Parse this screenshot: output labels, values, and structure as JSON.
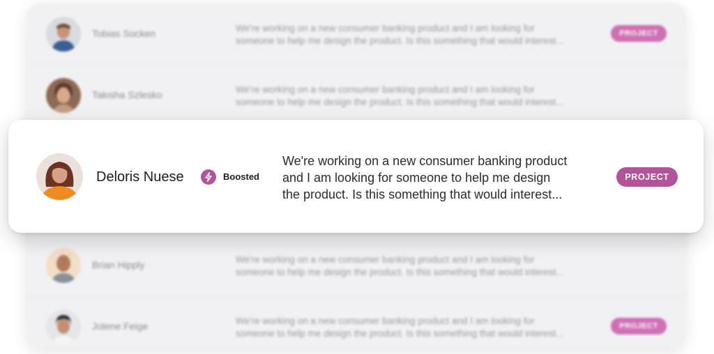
{
  "rows": [
    {
      "name": "Tobias Socken",
      "message_line1": "We're working on a new consumer banking product and I am looking for",
      "message_line2": "someone to help me design the product. Is this something that would interest...",
      "tag": "PROJECT"
    },
    {
      "name": "Takisha Szlesko",
      "message_line1": "We're working on a new consumer banking product and I am looking for",
      "message_line2": "someone to help me design the product. Is this something that would interest...",
      "tag": ""
    },
    {
      "name": "Brian Hipply",
      "message_line1": "We're working on a new consumer banking product and I am looking for",
      "message_line2": "someone to help me design the product. Is this something that would interest...",
      "tag": ""
    },
    {
      "name": "Jolene Feige",
      "message_line1": "We're working on a new consumer banking product and I am looking for",
      "message_line2": "someone to help me design the product. Is this something that would interest...",
      "tag": "PROJECT"
    }
  ],
  "focused": {
    "name": "Deloris Nuese",
    "boost_icon": "lightning-bolt-icon",
    "boost_label": "Boosted",
    "message_line1": "We're working on a new consumer banking product",
    "message_line2": "and I am looking for someone to help me design",
    "message_line3": "the product. Is this something that would interest...",
    "tag": "PROJECT"
  },
  "colors": {
    "accent": "#b3539a",
    "card_bg": "#f1f1f3"
  }
}
